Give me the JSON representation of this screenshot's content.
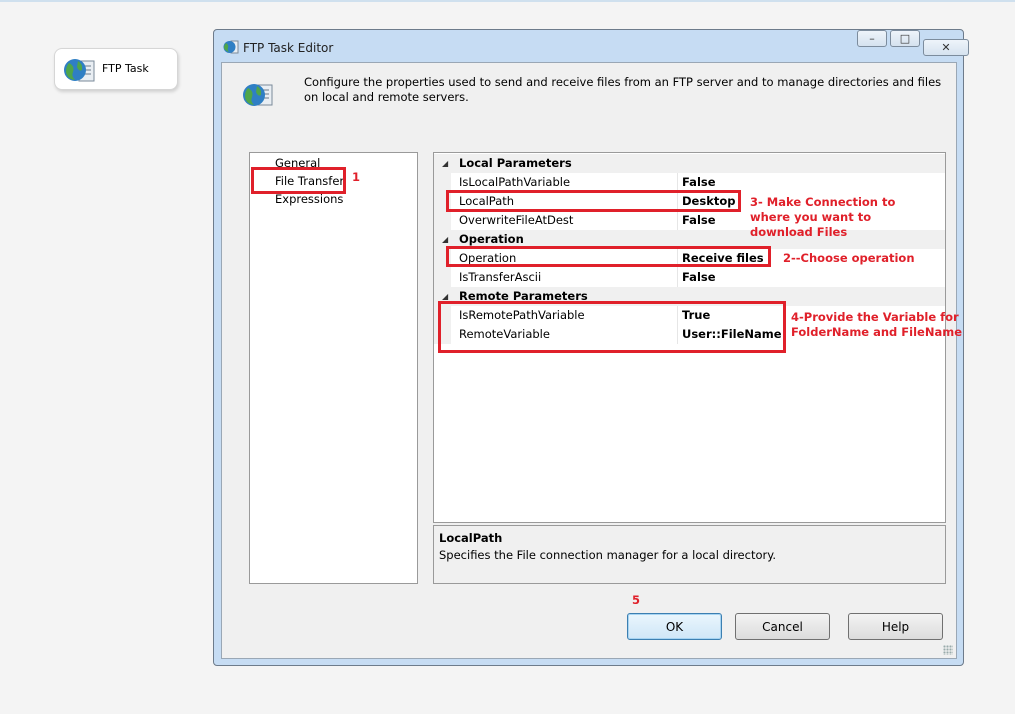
{
  "designer": {
    "task_label": "FTP Task"
  },
  "dialog": {
    "title": "FTP Task Editor",
    "description": "Configure the properties used to send and receive files from an FTP server and to manage directories and files on local and remote servers.",
    "window_buttons": {
      "minimize": "–",
      "restore": "□",
      "close": "✕"
    }
  },
  "nav": {
    "items": [
      "General",
      "File Transfer",
      "Expressions"
    ],
    "selected": "File Transfer"
  },
  "grid": {
    "categories": [
      {
        "name": "Local Parameters",
        "properties": [
          {
            "name": "IsLocalPathVariable",
            "value": "False"
          },
          {
            "name": "LocalPath",
            "value": "Desktop"
          },
          {
            "name": "OverwriteFileAtDest",
            "value": "False"
          }
        ]
      },
      {
        "name": "Operation",
        "properties": [
          {
            "name": "Operation",
            "value": "Receive files"
          },
          {
            "name": "IsTransferAscii",
            "value": "False"
          }
        ]
      },
      {
        "name": "Remote Parameters",
        "properties": [
          {
            "name": "IsRemotePathVariable",
            "value": "True"
          },
          {
            "name": "RemoteVariable",
            "value": "User::FileName"
          }
        ]
      }
    ]
  },
  "description_panel": {
    "title": "LocalPath",
    "text": "Specifies the File connection manager for a local directory."
  },
  "buttons": {
    "ok": "OK",
    "cancel": "Cancel",
    "help": "Help"
  },
  "annotations": {
    "n1": "1",
    "n2": "2--Choose operation",
    "n3_line1": "3- Make Connection to",
    "n3_line2": "where you want to",
    "n3_line3": "download Files",
    "n4_line1": "4-Provide the Variable for",
    "n4_line2": "FolderName and FileName",
    "n5": "5"
  },
  "colors": {
    "annotation": "#e0202a",
    "window_frame": "#c6dcf3"
  }
}
